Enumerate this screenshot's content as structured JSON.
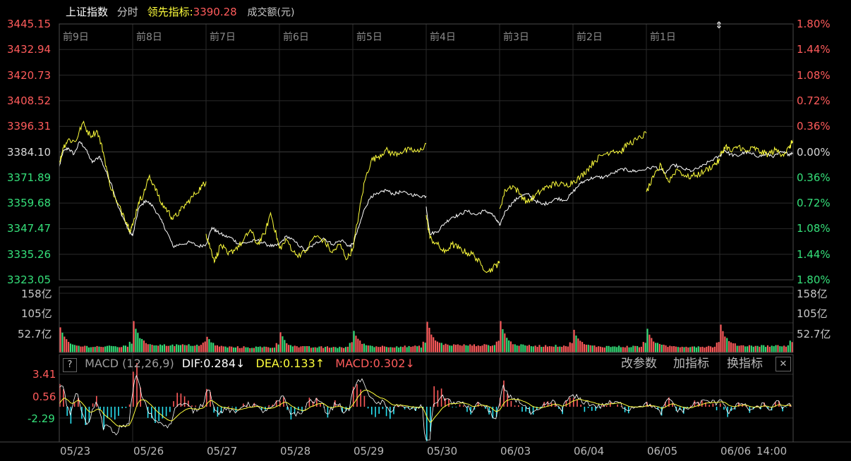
{
  "header": {
    "title": "上证指数",
    "mode": "分时",
    "lead_label": "领先指标",
    "lead_value": "3390.28",
    "volume_label": "成交额(元)"
  },
  "price_axis": {
    "left": [
      "3445.15",
      "3432.94",
      "3420.73",
      "3408.52",
      "3396.31",
      "3384.10",
      "3371.89",
      "3359.68",
      "3347.47",
      "3335.26",
      "3323.05"
    ],
    "right": [
      "1.80%",
      "1.44%",
      "1.08%",
      "0.72%",
      "0.36%",
      "0.00%",
      "0.36%",
      "0.72%",
      "1.08%",
      "1.44%",
      "1.80%"
    ]
  },
  "day_labels": [
    "前9日",
    "前8日",
    "前7日",
    "前6日",
    "前5日",
    "前4日",
    "前3日",
    "前2日",
    "前1日"
  ],
  "volume_axis": {
    "left": [
      "158亿",
      "105亿",
      "52.7亿"
    ],
    "right": [
      "158亿",
      "105亿",
      "52.7亿"
    ]
  },
  "macd_header": {
    "help": "?",
    "name": "MACD (12,26,9)",
    "dif": "DIF:0.284↓",
    "dea": "DEA:0.133↑",
    "macd": "MACD:0.302↓",
    "btn_params": "改参数",
    "btn_add": "加指标",
    "btn_switch": "换指标",
    "btn_close": "✕"
  },
  "macd_axis": [
    "3.41",
    "0.56",
    "-2.29"
  ],
  "dates": [
    "05/23",
    "05/26",
    "05/27",
    "05/28",
    "05/29",
    "05/30",
    "06/03",
    "06/04",
    "06/05",
    "06/06",
    "14:00"
  ],
  "colors": {
    "up": "#ff5b5b",
    "down": "#35e07a",
    "white": "#ffffff",
    "yellow": "#ffff3c",
    "cyan": "#29e0f0",
    "grid": "#2a2a2a"
  },
  "chart_data": {
    "type": "line",
    "title": "上证指数 分时",
    "y_range": [
      3323.05,
      3445.15
    ],
    "y_reference": 3384.1,
    "days": [
      "05/23",
      "05/26",
      "05/27",
      "05/28",
      "05/29",
      "05/30",
      "06/03",
      "06/04",
      "06/05",
      "06/06"
    ],
    "series": [
      {
        "name": "上证指数",
        "points": [
          [
            0.0,
            3377.0
          ],
          [
            0.05,
            3384.0
          ],
          [
            0.12,
            3386.0
          ],
          [
            0.2,
            3383.0
          ],
          [
            0.28,
            3389.0
          ],
          [
            0.35,
            3386.0
          ],
          [
            0.45,
            3379.0
          ],
          [
            0.55,
            3382.0
          ],
          [
            0.62,
            3376.0
          ],
          [
            0.72,
            3368.0
          ],
          [
            0.8,
            3358.0
          ],
          [
            0.88,
            3352.0
          ],
          [
            0.94,
            3347.0
          ],
          [
            1.0,
            3344.0
          ],
          [
            1.0,
            3344.0
          ],
          [
            1.08,
            3357.0
          ],
          [
            1.18,
            3361.0
          ],
          [
            1.28,
            3358.0
          ],
          [
            1.38,
            3352.0
          ],
          [
            1.48,
            3345.0
          ],
          [
            1.55,
            3339.0
          ],
          [
            1.65,
            3340.0
          ],
          [
            1.78,
            3341.0
          ],
          [
            1.9,
            3339.0
          ],
          [
            2.0,
            3340.0
          ],
          [
            2.0,
            3340.0
          ],
          [
            2.08,
            3348.0
          ],
          [
            2.15,
            3346.0
          ],
          [
            2.25,
            3344.0
          ],
          [
            2.35,
            3343.0
          ],
          [
            2.45,
            3340.0
          ],
          [
            2.58,
            3341.0
          ],
          [
            2.7,
            3342.0
          ],
          [
            2.82,
            3340.0
          ],
          [
            2.92,
            3339.0
          ],
          [
            3.0,
            3340.0
          ],
          [
            3.0,
            3340.0
          ],
          [
            3.1,
            3344.0
          ],
          [
            3.22,
            3341.0
          ],
          [
            3.35,
            3337.0
          ],
          [
            3.48,
            3340.0
          ],
          [
            3.6,
            3343.0
          ],
          [
            3.72,
            3340.0
          ],
          [
            3.85,
            3342.0
          ],
          [
            3.95,
            3339.0
          ],
          [
            4.0,
            3340.0
          ],
          [
            4.0,
            3340.0
          ],
          [
            4.08,
            3348.0
          ],
          [
            4.16,
            3357.0
          ],
          [
            4.25,
            3363.0
          ],
          [
            4.35,
            3364.0
          ],
          [
            4.45,
            3366.0
          ],
          [
            4.55,
            3364.0
          ],
          [
            4.65,
            3365.0
          ],
          [
            4.78,
            3364.0
          ],
          [
            4.9,
            3363.0
          ],
          [
            5.0,
            3363.0
          ],
          [
            5.0,
            3358.0
          ],
          [
            5.05,
            3345.0
          ],
          [
            5.15,
            3346.0
          ],
          [
            5.25,
            3350.0
          ],
          [
            5.35,
            3353.0
          ],
          [
            5.45,
            3354.0
          ],
          [
            5.55,
            3356.0
          ],
          [
            5.68,
            3354.0
          ],
          [
            5.78,
            3356.0
          ],
          [
            5.88,
            3355.0
          ],
          [
            5.95,
            3352.0
          ],
          [
            6.0,
            3349.0
          ],
          [
            6.0,
            3349.0
          ],
          [
            6.08,
            3356.0
          ],
          [
            6.18,
            3360.0
          ],
          [
            6.28,
            3363.0
          ],
          [
            6.38,
            3364.0
          ],
          [
            6.48,
            3361.0
          ],
          [
            6.58,
            3359.0
          ],
          [
            6.68,
            3360.0
          ],
          [
            6.78,
            3362.0
          ],
          [
            6.9,
            3361.0
          ],
          [
            7.0,
            3365.0
          ],
          [
            7.0,
            3365.0
          ],
          [
            7.1,
            3369.0
          ],
          [
            7.2,
            3371.0
          ],
          [
            7.3,
            3372.0
          ],
          [
            7.42,
            3372.0
          ],
          [
            7.55,
            3374.0
          ],
          [
            7.68,
            3376.0
          ],
          [
            7.78,
            3375.0
          ],
          [
            7.88,
            3375.0
          ],
          [
            8.0,
            3376.0
          ],
          [
            8.0,
            3376.0
          ],
          [
            8.12,
            3377.0
          ],
          [
            8.25,
            3374.0
          ],
          [
            8.38,
            3378.0
          ],
          [
            8.5,
            3376.0
          ],
          [
            8.62,
            3375.0
          ],
          [
            8.75,
            3377.0
          ],
          [
            8.88,
            3380.0
          ],
          [
            9.0,
            3382.0
          ],
          [
            9.0,
            3382.0
          ],
          [
            9.06,
            3385.0
          ],
          [
            9.14,
            3383.0
          ],
          [
            9.24,
            3382.0
          ],
          [
            9.34,
            3384.0
          ],
          [
            9.44,
            3383.0
          ],
          [
            9.54,
            3382.0
          ],
          [
            9.64,
            3383.0
          ],
          [
            9.74,
            3382.0
          ],
          [
            9.84,
            3384.0
          ],
          [
            9.94,
            3383.0
          ],
          [
            10.0,
            3384.0
          ]
        ]
      },
      {
        "name": "领先指标",
        "points": [
          [
            0.0,
            3378.0
          ],
          [
            0.05,
            3386.0
          ],
          [
            0.12,
            3390.0
          ],
          [
            0.22,
            3389.0
          ],
          [
            0.32,
            3398.0
          ],
          [
            0.42,
            3392.0
          ],
          [
            0.52,
            3394.0
          ],
          [
            0.6,
            3384.0
          ],
          [
            0.68,
            3370.0
          ],
          [
            0.78,
            3360.0
          ],
          [
            0.88,
            3354.0
          ],
          [
            0.96,
            3347.0
          ],
          [
            1.0,
            3349.0
          ],
          [
            1.0,
            3349.0
          ],
          [
            1.08,
            3360.0
          ],
          [
            1.15,
            3364.0
          ],
          [
            1.22,
            3372.0
          ],
          [
            1.3,
            3368.0
          ],
          [
            1.38,
            3360.0
          ],
          [
            1.48,
            3356.0
          ],
          [
            1.55,
            3352.0
          ],
          [
            1.65,
            3356.0
          ],
          [
            1.75,
            3360.0
          ],
          [
            1.85,
            3364.0
          ],
          [
            1.95,
            3368.0
          ],
          [
            2.0,
            3370.0
          ],
          [
            2.0,
            3345.0
          ],
          [
            2.06,
            3338.0
          ],
          [
            2.12,
            3332.0
          ],
          [
            2.2,
            3340.0
          ],
          [
            2.3,
            3335.0
          ],
          [
            2.4,
            3338.0
          ],
          [
            2.5,
            3341.0
          ],
          [
            2.6,
            3347.0
          ],
          [
            2.7,
            3340.0
          ],
          [
            2.8,
            3345.0
          ],
          [
            2.88,
            3355.0
          ],
          [
            2.96,
            3344.0
          ],
          [
            3.0,
            3338.0
          ],
          [
            3.0,
            3338.0
          ],
          [
            3.1,
            3342.0
          ],
          [
            3.22,
            3335.0
          ],
          [
            3.35,
            3336.0
          ],
          [
            3.48,
            3344.0
          ],
          [
            3.6,
            3342.0
          ],
          [
            3.72,
            3336.0
          ],
          [
            3.82,
            3340.0
          ],
          [
            3.92,
            3333.0
          ],
          [
            4.0,
            3338.0
          ],
          [
            4.0,
            3338.0
          ],
          [
            4.08,
            3354.0
          ],
          [
            4.16,
            3370.0
          ],
          [
            4.25,
            3380.0
          ],
          [
            4.35,
            3382.0
          ],
          [
            4.45,
            3385.0
          ],
          [
            4.55,
            3383.0
          ],
          [
            4.65,
            3384.0
          ],
          [
            4.78,
            3385.0
          ],
          [
            4.9,
            3384.0
          ],
          [
            5.0,
            3388.0
          ],
          [
            5.0,
            3354.0
          ],
          [
            5.05,
            3343.0
          ],
          [
            5.15,
            3340.0
          ],
          [
            5.25,
            3336.0
          ],
          [
            5.35,
            3340.0
          ],
          [
            5.45,
            3338.0
          ],
          [
            5.55,
            3336.0
          ],
          [
            5.65,
            3335.0
          ],
          [
            5.75,
            3330.0
          ],
          [
            5.85,
            3327.0
          ],
          [
            5.95,
            3330.0
          ],
          [
            6.0,
            3331.0
          ],
          [
            6.0,
            3357.0
          ],
          [
            6.08,
            3366.0
          ],
          [
            6.18,
            3368.0
          ],
          [
            6.28,
            3364.0
          ],
          [
            6.38,
            3360.0
          ],
          [
            6.48,
            3363.0
          ],
          [
            6.58,
            3366.0
          ],
          [
            6.68,
            3368.0
          ],
          [
            6.78,
            3369.0
          ],
          [
            6.9,
            3368.0
          ],
          [
            7.0,
            3370.0
          ],
          [
            7.0,
            3370.0
          ],
          [
            7.1,
            3372.0
          ],
          [
            7.2,
            3376.0
          ],
          [
            7.3,
            3380.0
          ],
          [
            7.42,
            3383.0
          ],
          [
            7.55,
            3385.0
          ],
          [
            7.65,
            3384.0
          ],
          [
            7.75,
            3388.0
          ],
          [
            7.88,
            3390.0
          ],
          [
            8.0,
            3393.0
          ],
          [
            8.0,
            3365.0
          ],
          [
            8.1,
            3372.0
          ],
          [
            8.2,
            3378.0
          ],
          [
            8.3,
            3370.0
          ],
          [
            8.42,
            3376.0
          ],
          [
            8.55,
            3372.0
          ],
          [
            8.68,
            3373.0
          ],
          [
            8.8,
            3375.0
          ],
          [
            8.92,
            3378.0
          ],
          [
            9.0,
            3380.0
          ],
          [
            9.0,
            3382.0
          ],
          [
            9.08,
            3387.0
          ],
          [
            9.16,
            3384.0
          ],
          [
            9.26,
            3387.0
          ],
          [
            9.36,
            3384.0
          ],
          [
            9.46,
            3386.0
          ],
          [
            9.56,
            3384.0
          ],
          [
            9.66,
            3383.0
          ],
          [
            9.76,
            3385.0
          ],
          [
            9.86,
            3383.0
          ],
          [
            9.95,
            3386.0
          ],
          [
            10.0,
            3390.28
          ]
        ]
      }
    ],
    "volume": {
      "unit": "亿",
      "ticks": [
        52.7,
        105,
        158
      ],
      "ymax": 170,
      "day_open_peaks": [
        72,
        90,
        45,
        58,
        62,
        88,
        90,
        65,
        68,
        80
      ],
      "baseline": [
        14,
        18,
        12,
        12,
        14,
        18,
        16,
        14,
        14,
        16
      ]
    },
    "macd": {
      "name": "MACD (12,26,9)",
      "DIF": 0.284,
      "DEA": 0.133,
      "MACD": 0.302,
      "y_range": [
        -5.1,
        4.8
      ],
      "ticks": [
        3.41,
        0.56,
        -2.29
      ]
    }
  }
}
